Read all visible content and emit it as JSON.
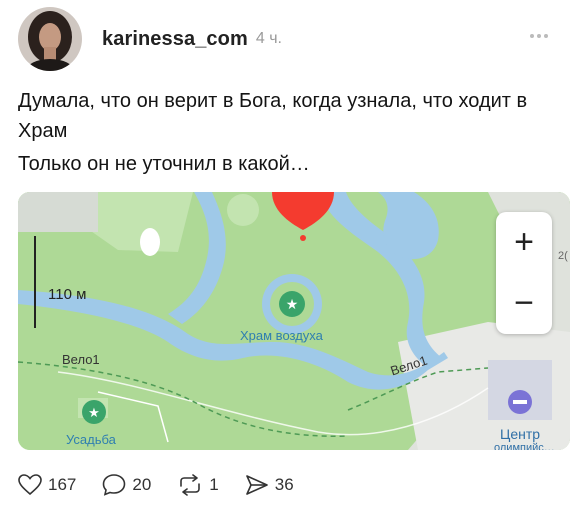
{
  "post": {
    "author": "karinessa_com",
    "time": "4 ч.",
    "lines": [
      "Думала, что он верит в Бога, когда узнала, что ходит в Храм",
      "Только он не уточнил в какой…"
    ]
  },
  "map": {
    "scale_label": "110 м",
    "zoom_in": "+",
    "zoom_out": "−",
    "place_label": "Храм воздуха",
    "velo_left": "Вело1",
    "velo_right": "Вело1",
    "manor_label": "Усадьба",
    "center_label": "Центр",
    "center_label_2": "олимпийс…",
    "edge_number": "2(",
    "colors": {
      "grass": "#aed996",
      "water": "#9fc9e8",
      "pin": "#f43b2f"
    }
  },
  "actions": {
    "likes": "167",
    "comments": "20",
    "reposts": "1",
    "views": "36"
  },
  "icons": [
    "heart-icon",
    "comment-icon",
    "repost-icon",
    "views-icon",
    "more-icon",
    "map-pin-icon",
    "star-icon"
  ]
}
